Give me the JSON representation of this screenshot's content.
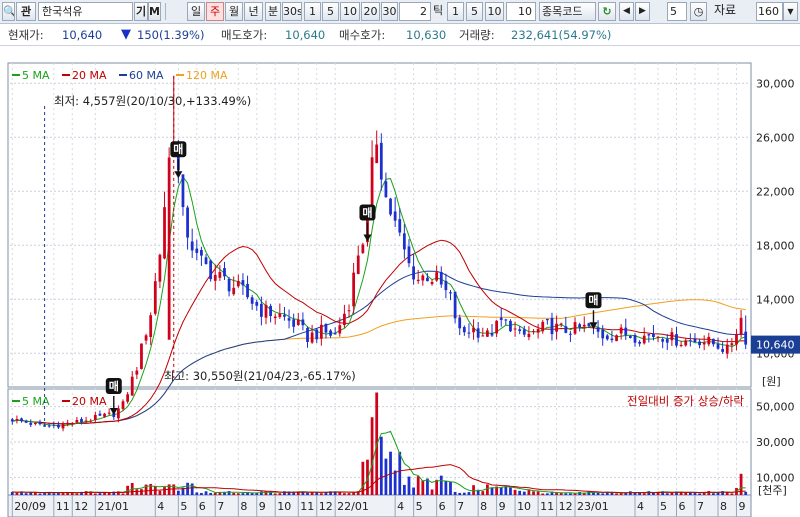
{
  "toolbar": {
    "search_icon": "🔍",
    "open_label": "관",
    "stock_name": "한국석유",
    "gi_label": "기",
    "m_label": "M",
    "periods": [
      "일",
      "주",
      "월",
      "년",
      "분",
      "30s"
    ],
    "active_period": "주",
    "intervals_a": [
      "1",
      "5",
      "10",
      "20",
      "30"
    ],
    "tick_value": "2",
    "tick_label": "틱",
    "intervals_b": [
      "1",
      "5",
      "10"
    ],
    "count_value": "10",
    "code_label": "종목코드 ",
    "refresh_icon": "↻",
    "prev_icon": "◀",
    "next_icon": "▶",
    "step_value": "5",
    "clock_icon": "◷",
    "data_label": "자료",
    "data_count": "160",
    "dropdown_icon": "▼"
  },
  "info": {
    "price_label": "현재가:",
    "price_value": "10,640",
    "change_arrow": "▼",
    "change_value": "150(1.39%)",
    "ask_label": "매도호가:",
    "ask_value": "10,640",
    "bid_label": "매수호가:",
    "bid_value": "10,630",
    "volume_label": "거래량:",
    "volume_value": "232,641(54.97%)"
  },
  "chart_data": [
    {
      "type": "candlestick",
      "legend": [
        {
          "name": "5 MA",
          "color": "#1aa21a"
        },
        {
          "name": "20 MA",
          "color": "#c00000"
        },
        {
          "name": "60 MA",
          "color": "#1c3f96"
        },
        {
          "name": "120 MA",
          "color": "#f0a020"
        }
      ],
      "y_ticks": [
        "30,000",
        "26,000",
        "22,000",
        "18,000",
        "14,000",
        "10,000"
      ],
      "ylim": [
        7500,
        31500
      ],
      "y_unit": "[원]",
      "x_ticks": [
        "20/09",
        "11",
        "12",
        "21/01",
        "4",
        "5",
        "6",
        "7",
        "8",
        "9",
        "10",
        "11",
        "12",
        "22/01",
        "4",
        "5",
        "6",
        "7",
        "8",
        "9",
        "10",
        "11",
        "12",
        "23/01",
        "4",
        "5",
        "6",
        "7",
        "8",
        "9"
      ],
      "current_price": "10,640",
      "annotations": {
        "low": "최저: 4,557원(20/10/30,+133.49%)",
        "high": "최고: 30,550원(21/04/23,-65.17%)"
      },
      "signals": [
        {
          "label": "매",
          "week": 22
        },
        {
          "label": "매",
          "week": 36
        },
        {
          "label": "매",
          "week": 77
        },
        {
          "label": "매",
          "week": 126
        }
      ],
      "colors": {
        "up": "#d0021b",
        "down": "#1c2fcf"
      }
    },
    {
      "type": "bar",
      "legend": [
        {
          "name": "5 MA",
          "color": "#1aa21a"
        },
        {
          "name": "20 MA",
          "color": "#c00000"
        }
      ],
      "caption": "전일대비 증가 상승/하락",
      "y_ticks": [
        "50,000",
        "30,000",
        "10,000"
      ],
      "ylim": [
        0,
        60000
      ],
      "y_unit": "[천주]"
    }
  ]
}
